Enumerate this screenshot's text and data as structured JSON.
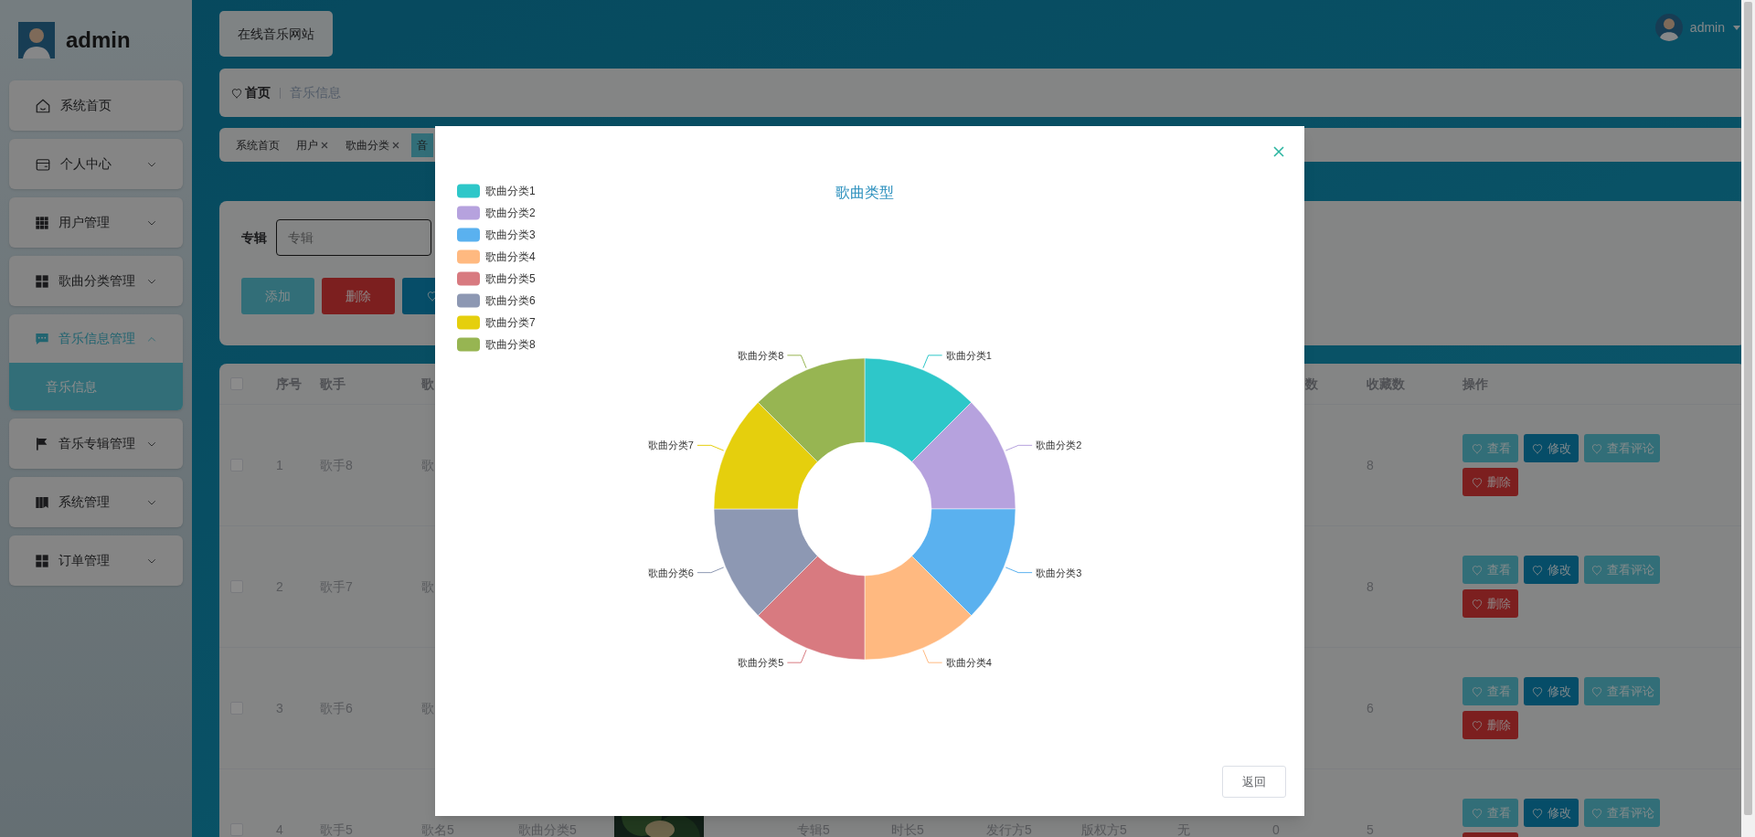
{
  "sidebar": {
    "user": "admin",
    "menu": [
      {
        "label": "系统首页",
        "kind": "link"
      },
      {
        "label": "个人中心",
        "kind": "submenu",
        "expanded": false
      },
      {
        "label": "用户管理",
        "kind": "submenu",
        "expanded": false
      },
      {
        "label": "歌曲分类管理",
        "kind": "submenu",
        "expanded": false
      },
      {
        "label": "音乐信息管理",
        "kind": "submenu",
        "expanded": true,
        "children": [
          {
            "label": "音乐信息",
            "selected": true
          }
        ]
      },
      {
        "label": "音乐专辑管理",
        "kind": "submenu",
        "expanded": false
      },
      {
        "label": "系统管理",
        "kind": "submenu",
        "expanded": false
      },
      {
        "label": "订单管理",
        "kind": "submenu",
        "expanded": false
      }
    ]
  },
  "header": {
    "site_button": "在线音乐网站",
    "user": "admin"
  },
  "breadcrumb": [
    "首页",
    "音乐信息"
  ],
  "tabs": [
    {
      "label": "系统首页",
      "closable": false,
      "selected": false
    },
    {
      "label": "用户",
      "closable": true,
      "selected": false
    },
    {
      "label": "歌曲分类",
      "closable": true,
      "selected": false
    },
    {
      "label": "音",
      "closable": false,
      "selected": true
    }
  ],
  "search": {
    "label": "专辑",
    "placeholder": "专辑",
    "buttons": [
      {
        "label": "添加",
        "kind": "add"
      },
      {
        "label": "删除",
        "kind": "delete"
      },
      {
        "kind": "icon"
      }
    ]
  },
  "table": {
    "select_all_checked": false,
    "header": {
      "number": "序号",
      "singer": "歌手",
      "song": "歌",
      "column_11": "数",
      "favorites": "收藏数",
      "actions": "操作"
    },
    "rows": [
      {
        "checked": false,
        "number": "1",
        "singer": "歌手8",
        "song": "歌",
        "favorites": "8",
        "actions": [
          {
            "label": "查看",
            "kind": "view"
          },
          {
            "label": "修改",
            "kind": "edit"
          },
          {
            "label": "查看评论",
            "kind": "comments"
          },
          {
            "label": "删除",
            "kind": "delete"
          }
        ]
      },
      {
        "checked": false,
        "number": "2",
        "singer": "歌手7",
        "song": "歌",
        "favorites": "8",
        "actions": [
          {
            "label": "查看",
            "kind": "view"
          },
          {
            "label": "修改",
            "kind": "edit"
          },
          {
            "label": "查看评论",
            "kind": "comments"
          },
          {
            "label": "删除",
            "kind": "delete"
          }
        ]
      },
      {
        "checked": false,
        "number": "3",
        "singer": "歌手6",
        "song": "歌",
        "favorites": "6",
        "actions": [
          {
            "label": "查看",
            "kind": "view"
          },
          {
            "label": "修改",
            "kind": "edit"
          },
          {
            "label": "查看评论",
            "kind": "comments"
          },
          {
            "label": "删除",
            "kind": "delete"
          }
        ]
      },
      {
        "checked": false,
        "number": "4",
        "singer": "歌手5",
        "song": "歌名5",
        "category": "歌曲分类5",
        "album": "专辑5",
        "duration": "时长5",
        "publisher": "发行方5",
        "copyright": "版权方5",
        "column_10": "无",
        "column_11": "0",
        "favorites": "5",
        "actions": [
          {
            "label": "查看",
            "kind": "view"
          },
          {
            "label": "修改",
            "kind": "edit"
          },
          {
            "label": "查看评论",
            "kind": "comments"
          },
          {
            "kind": "delete"
          }
        ]
      }
    ]
  },
  "modal": {
    "chart_title": "歌曲类型",
    "legend": [
      {
        "label": "歌曲分类1",
        "color": "#2ec7c9"
      },
      {
        "label": "歌曲分类2",
        "color": "#b6a2de"
      },
      {
        "label": "歌曲分类3",
        "color": "#5ab1ef"
      },
      {
        "label": "歌曲分类4",
        "color": "#ffb980"
      },
      {
        "label": "歌曲分类5",
        "color": "#d87a80"
      },
      {
        "label": "歌曲分类6",
        "color": "#8d98b3"
      },
      {
        "label": "歌曲分类7",
        "color": "#e5cf0d"
      },
      {
        "label": "歌曲分类8",
        "color": "#97b552"
      }
    ],
    "slices": [
      {
        "label": "歌曲分类1",
        "color": "#2ec7c9"
      },
      {
        "label": "歌曲分类2",
        "color": "#b6a2de"
      },
      {
        "label": "歌曲分类3",
        "color": "#5ab1ef"
      },
      {
        "label": "歌曲分类4",
        "color": "#ffb980"
      },
      {
        "label": "歌曲分类5",
        "color": "#d87a80"
      },
      {
        "label": "歌曲分类6",
        "color": "#8d98b3"
      },
      {
        "label": "歌曲分类7",
        "color": "#e5cf0d"
      },
      {
        "label": "歌曲分类8",
        "color": "#97b552"
      }
    ],
    "back_button": "返回"
  }
}
